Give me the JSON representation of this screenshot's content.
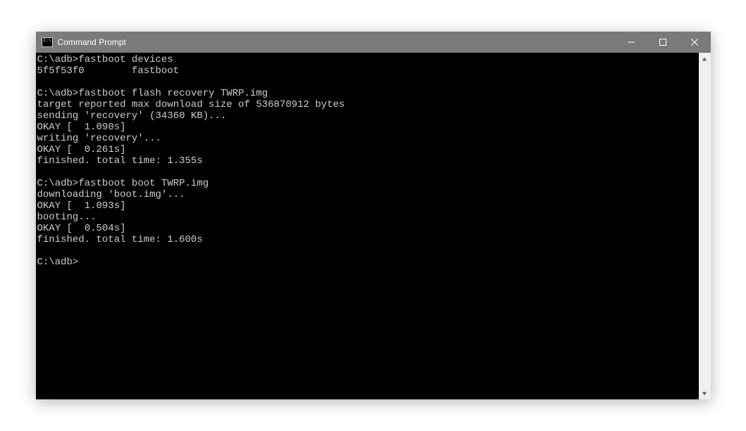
{
  "window": {
    "title": "Command Prompt"
  },
  "terminal": {
    "lines": [
      {
        "type": "cmd",
        "prompt": "C:\\adb>",
        "input": "fastboot devices"
      },
      {
        "type": "out",
        "text": "5f5f53f0        fastboot"
      },
      {
        "type": "blank"
      },
      {
        "type": "cmd",
        "prompt": "C:\\adb>",
        "input": "fastboot flash recovery TWRP.img"
      },
      {
        "type": "out",
        "text": "target reported max download size of 536870912 bytes"
      },
      {
        "type": "out",
        "text": "sending 'recovery' (34360 KB)..."
      },
      {
        "type": "out",
        "text": "OKAY [  1.090s]"
      },
      {
        "type": "out",
        "text": "writing 'recovery'..."
      },
      {
        "type": "out",
        "text": "OKAY [  0.261s]"
      },
      {
        "type": "out",
        "text": "finished. total time: 1.355s"
      },
      {
        "type": "blank"
      },
      {
        "type": "cmd",
        "prompt": "C:\\adb>",
        "input": "fastboot boot TWRP.img"
      },
      {
        "type": "out",
        "text": "downloading 'boot.img'..."
      },
      {
        "type": "out",
        "text": "OKAY [  1.093s]"
      },
      {
        "type": "out",
        "text": "booting..."
      },
      {
        "type": "out",
        "text": "OKAY [  0.504s]"
      },
      {
        "type": "out",
        "text": "finished. total time: 1.600s"
      },
      {
        "type": "blank"
      },
      {
        "type": "cmd",
        "prompt": "C:\\adb>",
        "input": ""
      }
    ]
  }
}
